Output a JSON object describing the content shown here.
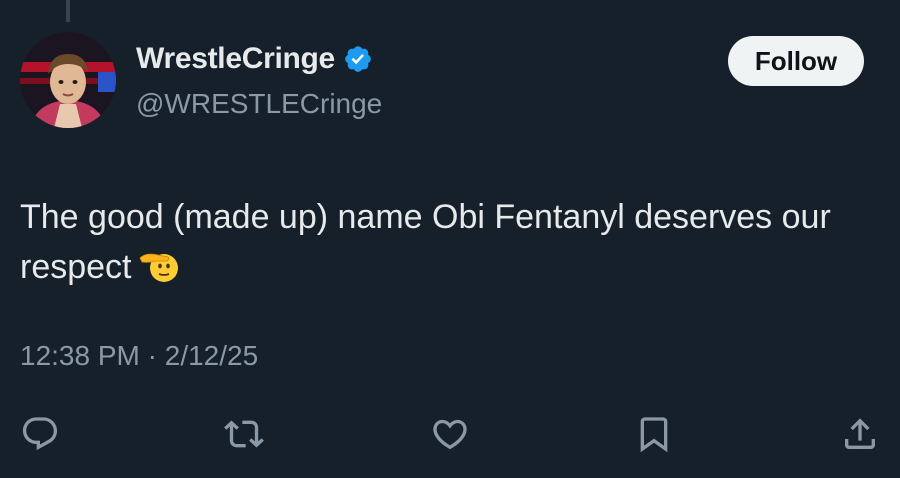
{
  "author": {
    "display_name": "WrestleCringe",
    "handle": "@WRESTLECringe",
    "verified": true,
    "avatar_icon": "avatar-icon"
  },
  "follow_button": {
    "label": "Follow"
  },
  "tweet": {
    "text": "The good (made up) name Obi Fentanyl deserves our respect",
    "emoji": "saluting-face-icon"
  },
  "meta": {
    "time": "12:38 PM",
    "separator": "·",
    "date": "2/12/25"
  },
  "actions": [
    {
      "icon": "reply-icon"
    },
    {
      "icon": "retweet-icon"
    },
    {
      "icon": "like-icon"
    },
    {
      "icon": "bookmark-icon"
    },
    {
      "icon": "share-icon"
    }
  ],
  "colors": {
    "background": "#15202b",
    "text": "#e7e9ea",
    "secondary": "#8b98a5",
    "verified": "#1d9bf0",
    "follow_bg": "#eff3f4"
  }
}
